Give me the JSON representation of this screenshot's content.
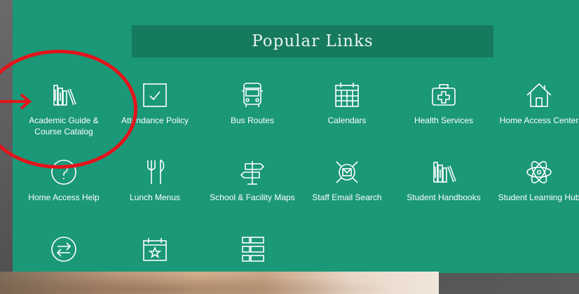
{
  "section": {
    "title": "Popular Links"
  },
  "links": [
    {
      "label": "Academic Guide & Course Catalog",
      "icon": "books-icon"
    },
    {
      "label": "Attendance Policy",
      "icon": "checkbox-icon"
    },
    {
      "label": "Bus Routes",
      "icon": "bus-icon"
    },
    {
      "label": "Calendars",
      "icon": "calendar-icon"
    },
    {
      "label": "Health Services",
      "icon": "first-aid-kit-icon"
    },
    {
      "label": "Home Access Center",
      "icon": "house-icon"
    },
    {
      "label": "Home Access Help",
      "icon": "question-icon"
    },
    {
      "label": "Lunch Menus",
      "icon": "fork-knife-icon"
    },
    {
      "label": "School & Facility Maps",
      "icon": "signpost-icon"
    },
    {
      "label": "Staff Email Search",
      "icon": "email-search-icon"
    },
    {
      "label": "Student Handbooks",
      "icon": "books-icon"
    },
    {
      "label": "Student Learning Hub",
      "icon": "atom-icon"
    },
    {
      "label": "",
      "icon": "exchange-arrows-icon"
    },
    {
      "label": "",
      "icon": "calendar-star-icon"
    },
    {
      "label": "",
      "icon": "list-grid-icon"
    }
  ],
  "annotation": {
    "color": "#e3141b",
    "shape": "circle-with-arrow"
  },
  "colors": {
    "panel": "#1a9878",
    "title_bar": "#167a5f",
    "text": "#ffffff"
  }
}
